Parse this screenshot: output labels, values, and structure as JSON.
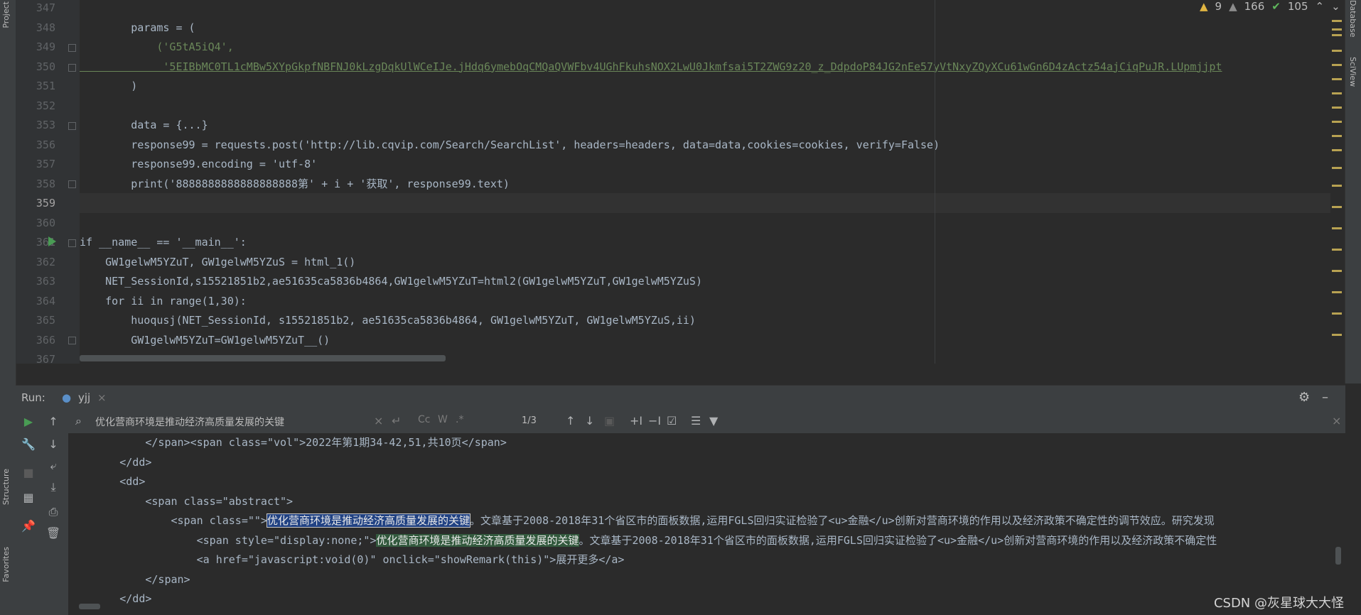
{
  "inspection": {
    "warnings": "9",
    "weak_warnings": "166",
    "typos": "105"
  },
  "side_tabs": {
    "left": [
      "Project",
      "Structure",
      "Favorites"
    ],
    "right": [
      "Database",
      "SciView"
    ]
  },
  "editor": {
    "lines": [
      {
        "num": "347",
        "text": ""
      },
      {
        "num": "348",
        "text": "        params = ("
      },
      {
        "num": "349",
        "text": "            ('G5tA5iQ4',"
      },
      {
        "num": "350",
        "text": "             '5EIBbMC0TL1cMBw5XYpGkpfNBFNJ0kLzgDqkUlWCeIJe.jHdq6ymebOqCMQaQVWFbv4UGhFkuhsNOX2LwU0Jkmfsai5T2ZWG9z20_z_DdpdoP84JG2nEe57yVtNxyZQyXCu61wGn6D4zActz54ajCiqPuJR.LUpmjjpt"
      },
      {
        "num": "351",
        "text": "        )"
      },
      {
        "num": "352",
        "text": ""
      },
      {
        "num": "353",
        "text": "        data = {...}"
      },
      {
        "num": "356",
        "text": "        response99 = requests.post('http://lib.cqvip.com/Search/SearchList', headers=headers, data=data,cookies=cookies, verify=False)"
      },
      {
        "num": "357",
        "text": "        response99.encoding = 'utf-8'"
      },
      {
        "num": "358",
        "text": "        print('8888888888888888888第' + i + '获取', response99.text)"
      },
      {
        "num": "359",
        "text": ""
      },
      {
        "num": "360",
        "text": ""
      },
      {
        "num": "361",
        "text": "if __name__ == '__main__':"
      },
      {
        "num": "362",
        "text": "    GW1gelwM5YZuT, GW1gelwM5YZuS = html_1()"
      },
      {
        "num": "363",
        "text": "    NET_SessionId,s15521851b2,ae51635ca5836b4864,GW1gelwM5YZuT=html2(GW1gelwM5YZuT,GW1gelwM5YZuS)"
      },
      {
        "num": "364",
        "text": "    for ii in range(1,30):"
      },
      {
        "num": "365",
        "text": "        huoqusj(NET_SessionId, s15521851b2, ae51635ca5836b4864, GW1gelwM5YZuT, GW1gelwM5YZuS,ii)"
      },
      {
        "num": "366",
        "text": "        GW1gelwM5YZuT=GW1gelwM5YZuT__()"
      },
      {
        "num": "367",
        "text": ""
      }
    ]
  },
  "run": {
    "label": "Run:",
    "tab_name": "yjj",
    "search_query": "优化营商环境是推动经济高质量发展的关键",
    "match_count": "1/3",
    "toggle_cc": "Cc",
    "toggle_w": "W",
    "toggle_regex": ".*"
  },
  "console": {
    "line1": "            </span><span class=\"vol\">2022年第1期34-42,51,共10页</span>",
    "line2": "        </dd>",
    "line3": "        <dd>",
    "line4": "            <span class=\"abstract\">",
    "line5_pre": "                <span class=\"\">",
    "line5_match": "优化营商环境是推动经济高质量发展的关键",
    "line5_post": "。文章基于2008-2018年31个省区市的面板数据,运用FGLS回归实证检验了<u>金融</u>创新对营商环境的作用以及经济政策不确定性的调节效应。研究发现",
    "line6_pre": "                    <span style=\"display:none;\">",
    "line6_match": "优化营商环境是推动经济高质量发展的关键",
    "line6_post": "。文章基于2008-2018年31个省区市的面板数据,运用FGLS回归实证检验了<u>金融</u>创新对营商环境的作用以及经济政策不确定性",
    "line7": "                    <a href=\"javascript:void(0)\" onclick=\"showRemark(this)\">展开更多</a>",
    "line8": "            </span>",
    "line9": "        </dd>"
  },
  "watermark": "CSDN @灰星球大大怪"
}
